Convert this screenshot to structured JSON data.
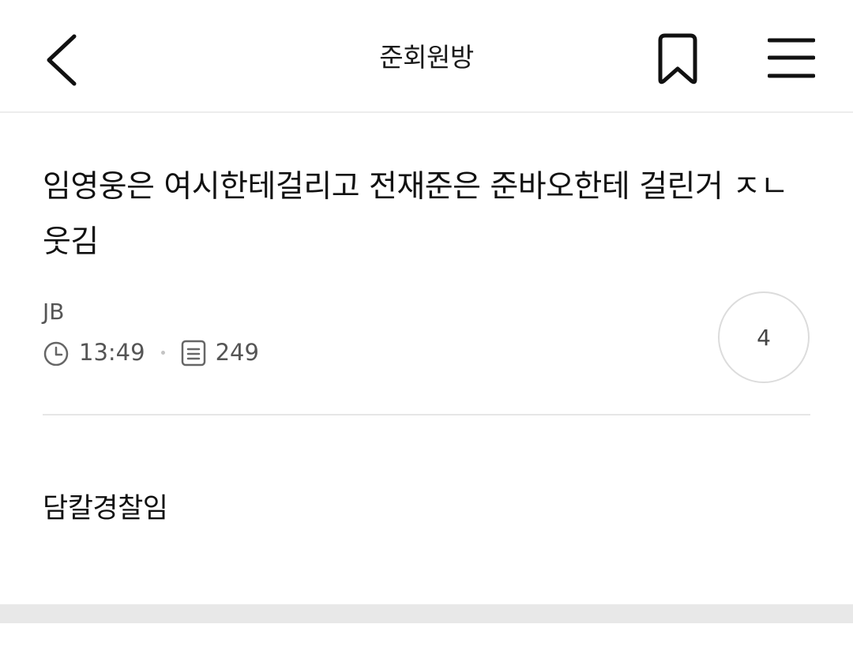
{
  "header": {
    "title": "준회원방",
    "back_icon": "chevron-left-icon",
    "bookmark_icon": "bookmark-icon",
    "menu_icon": "hamburger-menu-icon"
  },
  "post": {
    "title": "임영웅은 여시한테걸리고 전재준은 준바오한테 걸린거 ㅈㄴ 웃김",
    "author": "JB",
    "time": "13:49",
    "views": "249",
    "comment_count": "4",
    "body": "담칼경찰임"
  },
  "colors": {
    "text_primary": "#111111",
    "text_secondary": "#555555",
    "divider": "#e6e6e6",
    "band": "#e8e8e8"
  }
}
